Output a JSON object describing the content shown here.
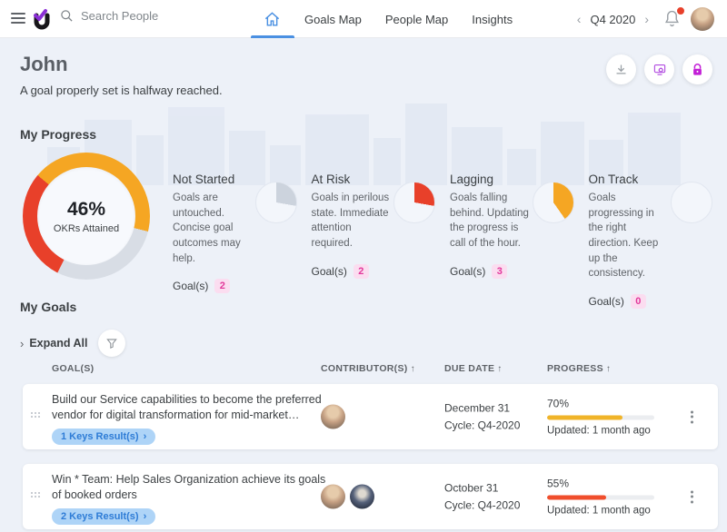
{
  "topbar": {
    "search_placeholder": "Search People",
    "tabs": [
      {
        "label": "Goals Map"
      },
      {
        "label": "People Map"
      },
      {
        "label": "Insights"
      }
    ],
    "period": "Q4 2020"
  },
  "header": {
    "title": "John",
    "subtitle": "A goal properly set is halfway reached."
  },
  "colors": {
    "accent_blue": "#4a90e2",
    "orange": "#f5a623",
    "red": "#e8402a",
    "gray_segment": "#d8dde5",
    "pink_badge_bg": "#fbddf0",
    "pink_badge_text": "#e2399b",
    "pill_bg": "#aed4f7",
    "pill_text": "#2e7cd6"
  },
  "progress": {
    "heading": "My Progress",
    "donut": {
      "percent": "46%",
      "caption": "OKRs Attained",
      "start_deg": 310,
      "segments": [
        {
          "label": "Lagging",
          "color": "#f5a623",
          "deg": 154
        },
        {
          "label": "Not Started",
          "color": "#d8dde5",
          "deg": 103
        },
        {
          "label": "At Risk",
          "color": "#e8402a",
          "deg": 103
        }
      ]
    },
    "statuses": [
      {
        "title": "Not Started",
        "description": "Goals are untouched. Concise goal outcomes may help.",
        "goals_label": "Goal(s)",
        "count": "2",
        "pie_deg": 100,
        "pie_color": "#ccd3dd"
      },
      {
        "title": "At Risk",
        "description": "Goals in perilous state. Immediate attention required.",
        "goals_label": "Goal(s)",
        "count": "2",
        "pie_deg": 100,
        "pie_color": "#e8402a"
      },
      {
        "title": "Lagging",
        "description": "Goals falling behind. Updating the progress is call of the hour.",
        "goals_label": "Goal(s)",
        "count": "3",
        "pie_deg": 145,
        "pie_color": "#f5a623"
      },
      {
        "title": "On Track",
        "description": "Goals progressing in the right direction. Keep up the consistency.",
        "goals_label": "Goal(s)",
        "count": "0",
        "pie_deg": 0,
        "pie_color": "#f5a623"
      }
    ]
  },
  "goals": {
    "heading": "My Goals",
    "expand_all": "Expand All",
    "columns": [
      "GOAL(S)",
      "CONTRIBUTOR(S)",
      "DUE DATE",
      "PROGRESS"
    ],
    "rows": [
      {
        "title": "Build our Service capabilities to become the preferred vendor for digital transformation for mid-market…",
        "keys_label": "1 Keys Result(s)",
        "contributors": [
          "male-bald"
        ],
        "due_date": "December 31",
        "cycle": "Cycle: Q4-2020",
        "percent": "70%",
        "progress": 70,
        "bar_color": "#f0b429",
        "updated": "Updated: 1 month ago"
      },
      {
        "title": "Win * Team: Help Sales Organization achieve its goals of booked orders",
        "keys_label": "2 Keys Result(s)",
        "contributors": [
          "male-bald",
          "male-dark"
        ],
        "due_date": "October 31",
        "cycle": "Cycle: Q4-2020",
        "percent": "55%",
        "progress": 55,
        "bar_color": "#f04e2c",
        "updated": "Updated: 1 month ago"
      }
    ]
  }
}
